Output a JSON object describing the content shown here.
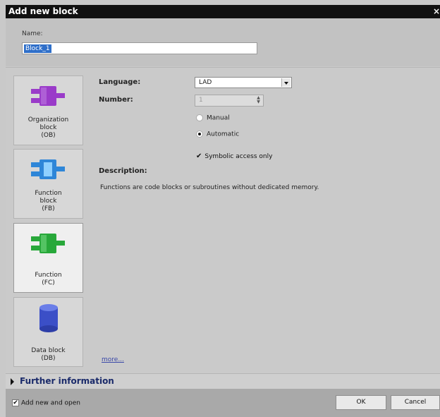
{
  "dialog": {
    "title": "Add new block",
    "close_glyph": "×"
  },
  "name": {
    "label": "Name:",
    "value": "Block_1"
  },
  "block_types": [
    {
      "label": "Organization\nblock\n(OB)",
      "icon": "organization-block-icon",
      "color": "#9a3bc9"
    },
    {
      "label": "Function\nblock\n(FB)",
      "icon": "function-block-icon",
      "color": "#2e86d8"
    },
    {
      "label": "Function\n(FC)",
      "icon": "function-icon",
      "color": "#28a83a",
      "selected": true
    },
    {
      "label": "Data block\n(DB)",
      "icon": "data-block-icon",
      "color": "#3b4fc7"
    }
  ],
  "language": {
    "label": "Language:",
    "value": "LAD"
  },
  "number": {
    "label": "Number:",
    "value": "1",
    "spin_up": "▲",
    "spin_down": "▼"
  },
  "numbering": {
    "manual_label": "Manual",
    "automatic_label": "Automatic",
    "selected": "Automatic"
  },
  "symbolic": {
    "label": "Symbolic access only",
    "checked": true,
    "check_glyph": "✔"
  },
  "description": {
    "label": "Description:",
    "text": "Functions are code blocks or subroutines without dedicated memory."
  },
  "more_link": "more...",
  "further_info": "Further information",
  "footer": {
    "add_open_label": "Add new and open",
    "add_open_checked": true,
    "check_glyph": "✔",
    "ok_label": "OK",
    "cancel_label": "Cancel"
  }
}
